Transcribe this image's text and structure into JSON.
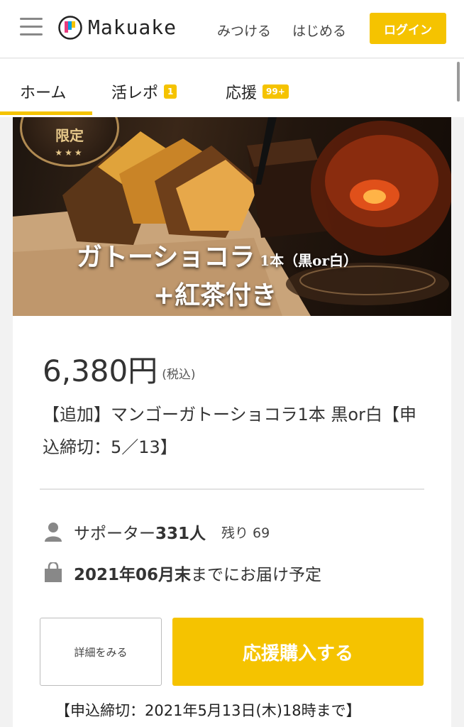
{
  "header": {
    "logo_text": "Makuake",
    "nav_find": "みつける",
    "nav_start": "はじめる",
    "login_label": "ログイン",
    "accent_color": "#f5c300"
  },
  "tabs": [
    {
      "label": "ホーム",
      "badge": "",
      "active": true
    },
    {
      "label": "活レポ",
      "badge": "1",
      "active": false
    },
    {
      "label": "応援",
      "badge": "99+",
      "active": false
    }
  ],
  "hero": {
    "seal_text": "限定",
    "seal_stars": "★★★",
    "title_main": "ガトーショコラ",
    "title_small": " 1本（黒or白）",
    "title_sub": "+紅茶付き"
  },
  "product": {
    "price": "6,380円",
    "tax_note": "(税込)",
    "title": "【追加】マンゴーガトーショコラ1本 黒or白【申込締切：5／13】",
    "supporters_prefix": "サポーター",
    "supporters_count": "331人",
    "remaining": "残り 69",
    "delivery_date": "2021年06月末",
    "delivery_suffix": "までにお届け予定",
    "detail_label": "詳細をみる",
    "buy_label": "応援購入する",
    "deadline": "【申込締切：2021年5月13日(木)18時まで】"
  }
}
